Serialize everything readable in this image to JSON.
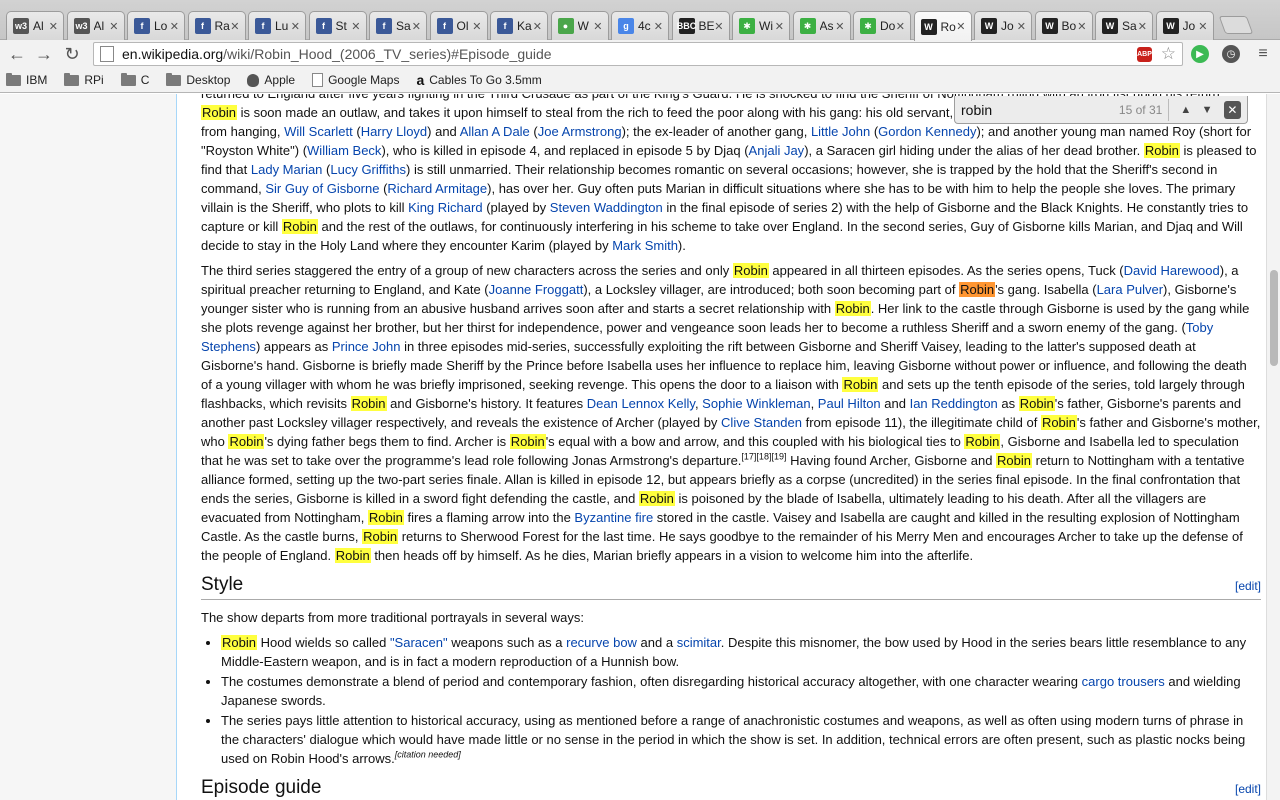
{
  "tabs": [
    {
      "label": "Al",
      "favicon": "w3",
      "color": "#555555"
    },
    {
      "label": "Al",
      "favicon": "w3",
      "color": "#555555"
    },
    {
      "label": "Lo",
      "favicon": "f",
      "color": "#3b5998"
    },
    {
      "label": "Ra",
      "favicon": "f",
      "color": "#3b5998"
    },
    {
      "label": "Lu",
      "favicon": "f",
      "color": "#3b5998"
    },
    {
      "label": "St",
      "favicon": "f",
      "color": "#3b5998"
    },
    {
      "label": "Sa",
      "favicon": "f",
      "color": "#3b5998"
    },
    {
      "label": "Ol",
      "favicon": "f",
      "color": "#3b5998"
    },
    {
      "label": "Ka",
      "favicon": "f",
      "color": "#3b5998"
    },
    {
      "label": "W",
      "favicon": "●",
      "color": "#4aa64a"
    },
    {
      "label": "4c",
      "favicon": "g",
      "color": "#4a86e8"
    },
    {
      "label": "BE",
      "favicon": "BBC",
      "color": "#222222"
    },
    {
      "label": "Wi",
      "favicon": "✱",
      "color": "#3cb043"
    },
    {
      "label": "As",
      "favicon": "✱",
      "color": "#3cb043"
    },
    {
      "label": "Do",
      "favicon": "✱",
      "color": "#3cb043"
    },
    {
      "label": "Ro",
      "favicon": "W",
      "color": "#222222"
    },
    {
      "label": "Jo",
      "favicon": "W",
      "color": "#222222"
    },
    {
      "label": "Bo",
      "favicon": "W",
      "color": "#222222"
    },
    {
      "label": "Sa",
      "favicon": "W",
      "color": "#222222"
    },
    {
      "label": "Jo",
      "favicon": "W",
      "color": "#222222"
    }
  ],
  "active_tab_index": 15,
  "address_bar": {
    "host": "en.wikipedia.org",
    "path": "/wiki/Robin_Hood_(2006_TV_series)#Episode_guide"
  },
  "bookmarks": [
    {
      "label": "IBM",
      "icon": "folder-icon"
    },
    {
      "label": "RPi",
      "icon": "folder-icon"
    },
    {
      "label": "C",
      "icon": "folder-icon"
    },
    {
      "label": "Desktop",
      "icon": "folder-icon"
    },
    {
      "label": "Apple",
      "icon": "apple-icon"
    },
    {
      "label": "Google Maps",
      "icon": "page-icon"
    },
    {
      "label": "Cables To Go 3.5mm",
      "icon": "amazon-icon"
    }
  ],
  "find_bar": {
    "query": "robin",
    "count": "15 of 31"
  },
  "article": {
    "p1": [
      {
        "t": "returned to England after five years fighting in the Third Crusade as part of the King's Guard. He is shocked to find the Sheriff of Nottingham ruling with an iron fist upon his return. "
      },
      {
        "t": "Robin",
        "h": 1
      },
      {
        "t": " is soon made an outlaw, and takes it upon himself to steal from the rich to feed the poor along with his gang: his old servant, "
      },
      {
        "t": "Much",
        "l": 1
      },
      {
        "t": " ("
      },
      {
        "t": "Sam Troughton",
        "l": 1
      },
      {
        "t": "); two young men he saved from hanging, "
      },
      {
        "t": "Will Scarlett",
        "l": 1
      },
      {
        "t": " ("
      },
      {
        "t": "Harry Lloyd",
        "l": 1
      },
      {
        "t": ") and "
      },
      {
        "t": "Allan A Dale",
        "l": 1
      },
      {
        "t": " ("
      },
      {
        "t": "Joe Armstrong",
        "l": 1
      },
      {
        "t": "); the ex-leader of another gang, "
      },
      {
        "t": "Little John",
        "l": 1
      },
      {
        "t": " ("
      },
      {
        "t": "Gordon Kennedy",
        "l": 1
      },
      {
        "t": "); and another young man named Roy (short for \"Royston White\") ("
      },
      {
        "t": "William Beck",
        "l": 1
      },
      {
        "t": "), who is killed in episode 4, and replaced in episode 5 by Djaq ("
      },
      {
        "t": "Anjali Jay",
        "l": 1
      },
      {
        "t": "), a Saracen girl hiding under the alias of her dead brother. "
      },
      {
        "t": "Robin",
        "h": 1
      },
      {
        "t": " is pleased to find that "
      },
      {
        "t": "Lady Marian",
        "l": 1
      },
      {
        "t": " ("
      },
      {
        "t": "Lucy Griffiths",
        "l": 1
      },
      {
        "t": ") is still unmarried. Their relationship becomes romantic on several occasions; however, she is trapped by the hold that the Sheriff's second in command, "
      },
      {
        "t": "Sir Guy of Gisborne",
        "l": 1
      },
      {
        "t": " ("
      },
      {
        "t": "Richard Armitage",
        "l": 1
      },
      {
        "t": "), has over her. Guy often puts Marian in difficult situations where she has to be with him to help the people she loves. The primary villain is the Sheriff, who plots to kill "
      },
      {
        "t": "King Richard",
        "l": 1
      },
      {
        "t": " (played by "
      },
      {
        "t": "Steven Waddington",
        "l": 1
      },
      {
        "t": " in the final episode of series 2) with the help of Gisborne and the Black Knights. He constantly tries to capture or kill "
      },
      {
        "t": "Robin",
        "h": 1
      },
      {
        "t": " and the rest of the outlaws, for continuously interfering in his scheme to take over England. In the second series, Guy of Gisborne kills Marian, and Djaq and Will decide to stay in the Holy Land where they encounter Karim (played by "
      },
      {
        "t": "Mark Smith",
        "l": 1
      },
      {
        "t": ")."
      }
    ],
    "p2": [
      {
        "t": "The third series staggered the entry of a group of new characters across the series and only "
      },
      {
        "t": "Robin",
        "h": 1
      },
      {
        "t": " appeared in all thirteen episodes. As the series opens, Tuck ("
      },
      {
        "t": "David Harewood",
        "l": 1
      },
      {
        "t": "), a spiritual preacher returning to England, and Kate ("
      },
      {
        "t": "Joanne Froggatt",
        "l": 1
      },
      {
        "t": "), a Locksley villager, are introduced; both soon becoming part of "
      },
      {
        "t": "Robin",
        "h": 2
      },
      {
        "t": "'s gang. Isabella ("
      },
      {
        "t": "Lara Pulver",
        "l": 1
      },
      {
        "t": "), Gisborne's younger sister who is running from an abusive husband arrives soon after and starts a secret relationship with "
      },
      {
        "t": "Robin",
        "h": 1
      },
      {
        "t": ". Her link to the castle through Gisborne is used by the gang while she plots revenge against her brother, but her thirst for independence, power and vengeance soon leads her to become a ruthless Sheriff and a sworn enemy of the gang. ("
      },
      {
        "t": "Toby Stephens",
        "l": 1
      },
      {
        "t": ") appears as "
      },
      {
        "t": "Prince John",
        "l": 1
      },
      {
        "t": " in three episodes mid-series, successfully exploiting the rift between Gisborne and Sheriff Vaisey, leading to the latter's supposed death at Gisborne's hand. Gisborne is briefly made Sheriff by the Prince before Isabella uses her influence to replace him, leaving Gisborne without power or influence, and following the death of a young villager with whom he was briefly imprisoned, seeking revenge. This opens the door to a liaison with "
      },
      {
        "t": "Robin",
        "h": 1
      },
      {
        "t": " and sets up the tenth episode of the series, told largely through flashbacks, which revisits "
      },
      {
        "t": "Robin",
        "h": 1
      },
      {
        "t": " and Gisborne's history. It features "
      },
      {
        "t": "Dean Lennox Kelly",
        "l": 1
      },
      {
        "t": ", "
      },
      {
        "t": "Sophie Winkleman",
        "l": 1
      },
      {
        "t": ", "
      },
      {
        "t": "Paul Hilton",
        "l": 1
      },
      {
        "t": " and "
      },
      {
        "t": "Ian Reddington",
        "l": 1
      },
      {
        "t": " as "
      },
      {
        "t": "Robin",
        "h": 1
      },
      {
        "t": "'s father, Gisborne's parents and another past Locksley villager respectively, and reveals the existence of Archer (played by "
      },
      {
        "t": "Clive Standen",
        "l": 1
      },
      {
        "t": " from episode 11), the illegitimate child of "
      },
      {
        "t": "Robin",
        "h": 1
      },
      {
        "t": "'s father and Gisborne's mother, who "
      },
      {
        "t": "Robin",
        "h": 1
      },
      {
        "t": "'s dying father begs them to find. Archer is "
      },
      {
        "t": "Robin",
        "h": 1
      },
      {
        "t": "'s equal with a bow and arrow, and this coupled with his biological ties to "
      },
      {
        "t": "Robin",
        "h": 1
      },
      {
        "t": ", Gisborne and Isabella led to speculation that he was set to take over the programme's lead role following Jonas Armstrong's departure."
      },
      {
        "t": "[17][18][19]",
        "sup": 1
      },
      {
        "t": " Having found Archer, Gisborne and "
      },
      {
        "t": "Robin",
        "h": 1
      },
      {
        "t": " return to Nottingham with a tentative alliance formed, setting up the two-part series finale. Allan is killed in episode 12, but appears briefly as a corpse (uncredited) in the series final episode. In the final confrontation that ends the series, Gisborne is killed in a sword fight defending the castle, and "
      },
      {
        "t": "Robin",
        "h": 1
      },
      {
        "t": " is poisoned by the blade of Isabella, ultimately leading to his death. After all the villagers are evacuated from Nottingham, "
      },
      {
        "t": "Robin",
        "h": 1
      },
      {
        "t": " fires a flaming arrow into the "
      },
      {
        "t": "Byzantine fire",
        "l": 1
      },
      {
        "t": " stored in the castle. Vaisey and Isabella are caught and killed in the resulting explosion of Nottingham Castle. As the castle burns, "
      },
      {
        "t": "Robin",
        "h": 1
      },
      {
        "t": " returns to Sherwood Forest for the last time. He says goodbye to the remainder of his Merry Men and encourages Archer to take up the defense of the people of England. "
      },
      {
        "t": "Robin",
        "h": 1
      },
      {
        "t": " then heads off by himself. As he dies, Marian briefly appears in a vision to welcome him into the afterlife."
      }
    ],
    "style_heading": "Style",
    "edit_label": "[edit]",
    "style_intro": "The show departs from more traditional portrayals in several ways:",
    "bullets": [
      [
        {
          "t": "Robin",
          "h": 1
        },
        {
          "t": " Hood wields so called "
        },
        {
          "t": "\"Saracen\"",
          "l": 1
        },
        {
          "t": " weapons such as a "
        },
        {
          "t": "recurve bow",
          "l": 1
        },
        {
          "t": " and a "
        },
        {
          "t": "scimitar",
          "l": 1
        },
        {
          "t": ". Despite this misnomer, the bow used by Hood in the series bears little resemblance to any Middle-Eastern weapon, and is in fact a modern reproduction of a Hunnish bow."
        }
      ],
      [
        {
          "t": "The costumes demonstrate a blend of period and contemporary fashion, often disregarding historical accuracy altogether, with one character wearing "
        },
        {
          "t": "cargo trousers",
          "l": 1
        },
        {
          "t": " and wielding Japanese swords."
        }
      ],
      [
        {
          "t": "The series pays little attention to historical accuracy, using as mentioned before a range of anachronistic costumes and weapons, as well as often using modern turns of phrase in the characters' dialogue which would have made little or no sense in the period in which the show is set. In addition, technical errors are often present, such as plastic nocks being used on Robin Hood's arrows."
        },
        {
          "t": "[citation needed]",
          "sup": 1,
          "i": 1
        }
      ]
    ],
    "episode_heading": "Episode guide"
  }
}
